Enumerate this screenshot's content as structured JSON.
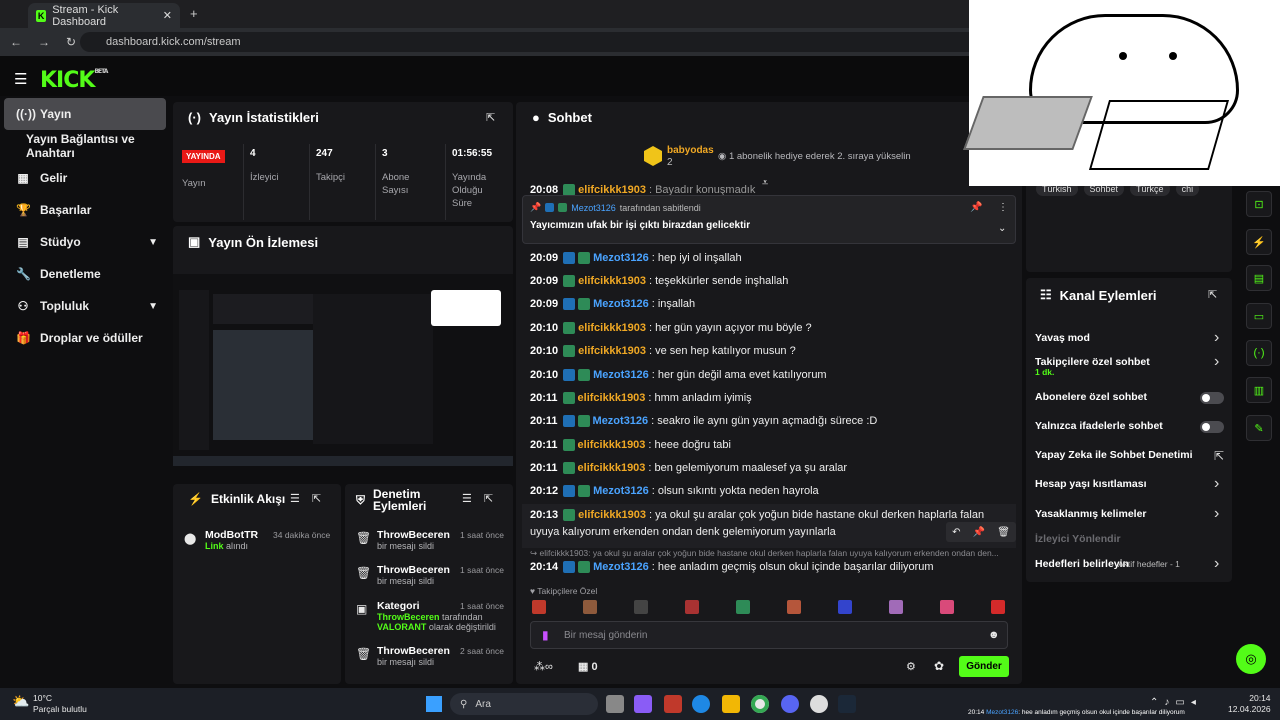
{
  "browser": {
    "tab_title": "Stream - Kick Dashboard",
    "url": "dashboard.kick.com/stream"
  },
  "brand": {
    "logo": "KICK",
    "logo_sup": "BETA",
    "accent": "#53fc18"
  },
  "sidebar": {
    "items": [
      {
        "label": "Yayın",
        "icon": "broadcast-icon"
      },
      {
        "label": "Yayın Bağlantısı ve Anahtarı",
        "icon": ""
      },
      {
        "label": "Gelir",
        "icon": "revenue-icon"
      },
      {
        "label": "Başarılar",
        "icon": "trophy-icon"
      },
      {
        "label": "Stüdyo",
        "icon": "studio-icon"
      },
      {
        "label": "Denetleme",
        "icon": "wrench-icon"
      },
      {
        "label": "Topluluk",
        "icon": "community-icon"
      },
      {
        "label": "Droplar ve ödüller",
        "icon": "gift-icon"
      }
    ]
  },
  "stats": {
    "title": "Yayın İstatistikleri",
    "live": "YAYINDA",
    "live_label": "Yayın",
    "items": [
      {
        "value": "4",
        "label": "İzleyici"
      },
      {
        "value": "247",
        "label": "Takipçi"
      },
      {
        "value": "3",
        "label": "Abone Sayısı"
      },
      {
        "value": "01:56:55",
        "label": "Yayında Olduğu Süre"
      }
    ]
  },
  "preview": {
    "title": "Yayın Ön İzlemesi"
  },
  "activity": {
    "title": "Etkinlik Akışı",
    "items": [
      {
        "name": "ModBotTR",
        "time": "34 dakika önce",
        "action_accent": "Link",
        "action": "alındı"
      }
    ]
  },
  "moderation": {
    "title": "Denetim Eylemleri",
    "items": [
      {
        "name": "ThrowBeceren",
        "time": "1 saat önce",
        "desc": "bir mesajı sildi"
      },
      {
        "name": "ThrowBeceren",
        "time": "1 saat önce",
        "desc": "bir mesajı sildi"
      },
      {
        "name": "Kategori",
        "time": "1 saat önce",
        "desc_user": "ThrowBeceren",
        "desc": "tarafından",
        "desc_game": "VALORANT",
        "desc2": "olarak değiştirildi"
      },
      {
        "name": "ThrowBeceren",
        "time": "2 saat önce",
        "desc": "bir mesajı sildi"
      }
    ]
  },
  "chat": {
    "title": "Sohbet",
    "gift": {
      "user": "babyodas",
      "count": "2",
      "text": "1 abonelik hediye ederek 2. sıraya yükselin"
    },
    "partial": {
      "time": "20:08",
      "user": "elifcikkk1903",
      "text": "Bayadır konuşmadık"
    },
    "pinned": {
      "by_user": "Mezot3126",
      "by_text": "tarafından sabitlendi",
      "text": "Yayıcımızın ufak bir işi çıktı birazdan gelicektir"
    },
    "messages": [
      {
        "time": "20:09",
        "user": "Mezot3126",
        "mod": true,
        "text": "hep iyi ol inşallah"
      },
      {
        "time": "20:09",
        "user": "elifcikkk1903",
        "mod": false,
        "text": "teşekkürler sende inşhallah"
      },
      {
        "time": "20:09",
        "user": "Mezot3126",
        "mod": true,
        "text": "inşallah"
      },
      {
        "time": "20:10",
        "user": "elifcikkk1903",
        "mod": false,
        "text": "her gün yayın açıyor mu böyle ?"
      },
      {
        "time": "20:10",
        "user": "elifcikkk1903",
        "mod": false,
        "text": "ve sen hep katılıyor musun ?"
      },
      {
        "time": "20:10",
        "user": "Mezot3126",
        "mod": true,
        "text": "her gün değil ama evet katılıyorum"
      },
      {
        "time": "20:11",
        "user": "elifcikkk1903",
        "mod": false,
        "text": "hmm anladım iyimiş"
      },
      {
        "time": "20:11",
        "user": "Mezot3126",
        "mod": true,
        "text": "seakro ile aynı gün yayın açmadığı sürece :D"
      },
      {
        "time": "20:11",
        "user": "elifcikkk1903",
        "mod": false,
        "text": "heee doğru tabi"
      },
      {
        "time": "20:11",
        "user": "elifcikkk1903",
        "mod": false,
        "text": "ben gelemiyorum maalesef ya şu aralar"
      },
      {
        "time": "20:12",
        "user": "Mezot3126",
        "mod": true,
        "text": "olsun sıkıntı yokta neden hayrola"
      }
    ],
    "long_msg": {
      "time": "20:13",
      "user": "elifcikkk1903",
      "line1": "ya okul şu aralar çok yoğun bide hastane okul derken haplarla falan",
      "line2": "uyuya kalıyorum erkenden ondan denk gelemiyorum yayınlarla"
    },
    "reply_ref": "elifcikkk1903: ya okul şu aralar çok yoğun bide hastane okul derken haplarla falan uyuya kalıyorum erkenden ondan den...",
    "last": {
      "time": "20:14",
      "user": "Mezot3126",
      "text": "hee anladım geçmiş olsun okul içinde başarılar diliyorum"
    },
    "followers_only": "Takipçilere Özel",
    "input_placeholder": "Bir mesaj gönderin",
    "points": "0",
    "send": "Gönder"
  },
  "tags": [
    "Türkish",
    "Sohbet",
    "Türkçe",
    "chi"
  ],
  "actions": {
    "title": "Kanal Eylemleri",
    "items": [
      {
        "label": "Yavaş mod",
        "type": "arrow"
      },
      {
        "label": "Takipçilere özel sohbet",
        "sub": "1 dk.",
        "type": "arrow"
      },
      {
        "label": "Abonelere özel sohbet",
        "type": "toggle"
      },
      {
        "label": "Yalnızca ifadelerle sohbet",
        "type": "toggle"
      },
      {
        "label": "Yapay Zeka ile Sohbet Denetimi",
        "type": "external"
      },
      {
        "label": "Hesap yaşı kısıtlaması",
        "type": "arrow"
      },
      {
        "label": "Yasaklanmış kelimeler",
        "type": "arrow"
      },
      {
        "label": "İzleyici Yönlendir",
        "type": "disabled"
      },
      {
        "label": "Hedefleri belirleyin",
        "sub": "Aktif hedefler - 1",
        "type": "arrow"
      }
    ]
  },
  "taskbar": {
    "weather_temp": "10°C",
    "weather_desc": "Parçalı bulutlu",
    "search": "Ara",
    "time": "20:14",
    "date": "12.04.2026",
    "ticker_time": "20:14",
    "ticker_user": "Mezot3126",
    "ticker_text": ": hee anladım geçmiş olsun okul içinde başarılar diliyorum"
  }
}
